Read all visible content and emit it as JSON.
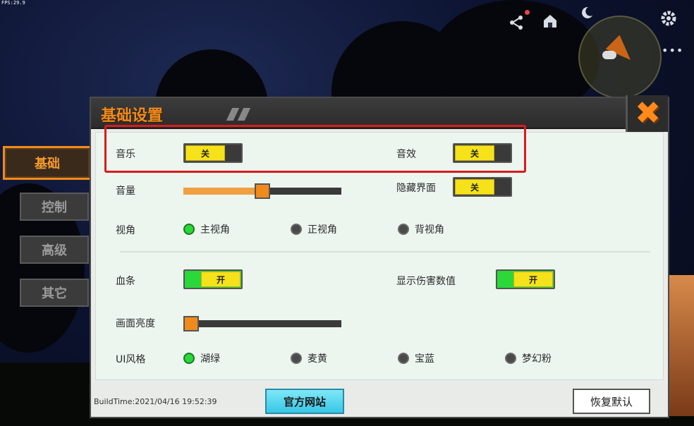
{
  "hud": {
    "fps": "FPS:29.9",
    "icons": [
      "share-icon",
      "home-icon",
      "moon-icon",
      "gear-icon"
    ],
    "minimap_more": "•••"
  },
  "sidebar": {
    "items": [
      {
        "label": "基础",
        "active": true
      },
      {
        "label": "控制",
        "active": false
      },
      {
        "label": "高级",
        "active": false
      },
      {
        "label": "其它",
        "active": false
      }
    ]
  },
  "panel": {
    "title": "基础设置",
    "close_glyph": "✖"
  },
  "settings": {
    "music": {
      "label": "音乐",
      "state": "关"
    },
    "sound_effects": {
      "label": "音效",
      "state": "关"
    },
    "volume": {
      "label": "音量",
      "value": 0.5
    },
    "hide_ui": {
      "label": "隐藏界面",
      "state": "关"
    },
    "view": {
      "label": "视角",
      "options": [
        "主视角",
        "正视角",
        "背视角"
      ],
      "selected": "主视角"
    },
    "health_bar": {
      "label": "血条",
      "state": "开"
    },
    "show_damage": {
      "label": "显示伤害数值",
      "state": "开"
    },
    "brightness": {
      "label": "画面亮度",
      "value": 0.02
    },
    "ui_style": {
      "label": "UI风格",
      "options": [
        "湖绿",
        "麦黄",
        "宝蓝",
        "梦幻粉"
      ],
      "selected": "湖绿"
    }
  },
  "footer": {
    "build_time": "BuildTime:2021/04/16 19:52:39",
    "website_button": "官方网站",
    "reset_button": "恢复默认"
  },
  "colors": {
    "accent": "#f08a1c",
    "toggle_knob": "#f5e21a",
    "toggle_on": "#2ad83a",
    "radio_checked": "#2ad83a",
    "highlight": "#d91c1c"
  }
}
